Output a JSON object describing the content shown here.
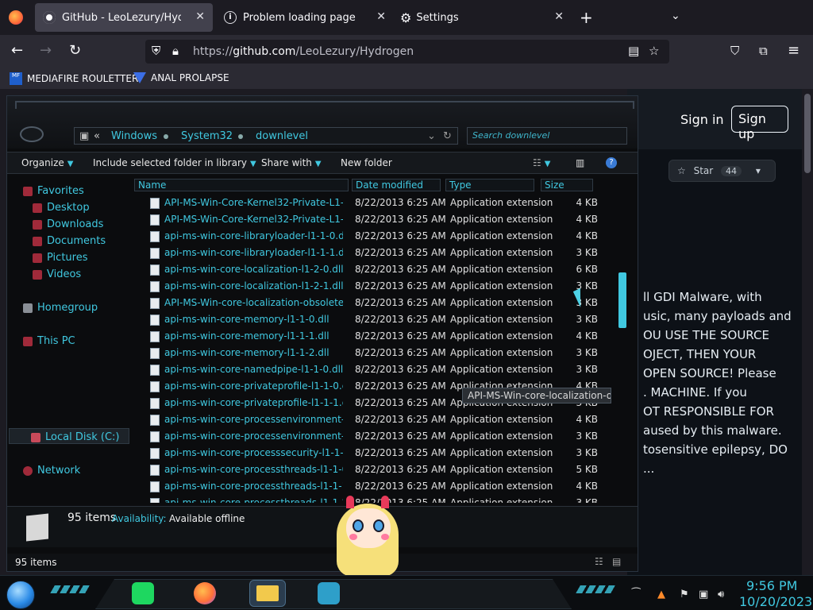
{
  "browser": {
    "tabs": [
      {
        "title": "GitHub - LeoLezury/Hydrogen",
        "icon": "github-icon"
      },
      {
        "title": "Problem loading page",
        "icon": "info-icon"
      },
      {
        "title": "Settings",
        "icon": "gear-icon"
      }
    ],
    "url_prefix": "https://",
    "url_domain": "github.com",
    "url_path": "/LeoLezury/Hydrogen",
    "bookmarks": [
      {
        "label": "MEDIAFIRE ROULETTER",
        "icon_text": "MF"
      },
      {
        "label": "ANAL PROLAPSE",
        "icon": "triangle-icon"
      }
    ]
  },
  "github": {
    "sign_in": "Sign in",
    "sign_up": "Sign up",
    "star_label": "Star",
    "star_count": "44",
    "readme_lines": [
      "ll GDI Malware, with",
      "usic, many payloads and",
      "OU USE THE SOURCE",
      "OJECT, THEN YOUR",
      " OPEN SOURCE! Please",
      ". MACHINE. If you",
      "OT RESPONSIBLE FOR",
      "aused by this malware.",
      "tosensitive epilepsy, DO",
      "..."
    ]
  },
  "explorer": {
    "breadcrumb": [
      "Windows",
      "System32",
      "downlevel"
    ],
    "breadcrumb_prefix": "«",
    "search_placeholder": "Search downlevel",
    "commands": {
      "organize": "Organize",
      "include": "Include selected folder in library",
      "share": "Share with",
      "new_folder": "New folder"
    },
    "nav": {
      "favorites": "Favorites",
      "desktop": "Desktop",
      "downloads": "Downloads",
      "documents": "Documents",
      "pictures": "Pictures",
      "videos": "Videos",
      "homegroup": "Homegroup",
      "this_pc": "This PC",
      "local_disk": "Local Disk (C:)",
      "network": "Network"
    },
    "columns": {
      "name": "Name",
      "date": "Date modified",
      "type": "Type",
      "size": "Size"
    },
    "files": [
      {
        "name": "API-MS-Win-Core-Kernel32-Private-L1-1-0.dll",
        "date": "8/22/2013 6:25 AM",
        "type": "Application extension",
        "size": "4 KB"
      },
      {
        "name": "API-MS-Win-Core-Kernel32-Private-L1-1-1.dll",
        "date": "8/22/2013 6:25 AM",
        "type": "Application extension",
        "size": "4 KB"
      },
      {
        "name": "api-ms-win-core-libraryloader-l1-1-0.dll",
        "date": "8/22/2013 6:25 AM",
        "type": "Application extension",
        "size": "4 KB"
      },
      {
        "name": "api-ms-win-core-libraryloader-l1-1-1.dll",
        "date": "8/22/2013 6:25 AM",
        "type": "Application extension",
        "size": "3 KB"
      },
      {
        "name": "api-ms-win-core-localization-l1-2-0.dll",
        "date": "8/22/2013 6:25 AM",
        "type": "Application extension",
        "size": "6 KB"
      },
      {
        "name": "api-ms-win-core-localization-l1-2-1.dll",
        "date": "8/22/2013 6:25 AM",
        "type": "Application extension",
        "size": "3 KB"
      },
      {
        "name": "API-MS-Win-core-localization-obsolete-l1-...",
        "date": "8/22/2013 6:25 AM",
        "type": "Application extension",
        "size": "3 KB"
      },
      {
        "name": "api-ms-win-core-memory-l1-1-0.dll",
        "date": "8/22/2013 6:25 AM",
        "type": "Application extension",
        "size": "3 KB"
      },
      {
        "name": "api-ms-win-core-memory-l1-1-1.dll",
        "date": "8/22/2013 6:25 AM",
        "type": "Application extension",
        "size": "4 KB"
      },
      {
        "name": "api-ms-win-core-memory-l1-1-2.dll",
        "date": "8/22/2013 6:25 AM",
        "type": "Application extension",
        "size": "3 KB"
      },
      {
        "name": "api-ms-win-core-namedpipe-l1-1-0.dll",
        "date": "8/22/2013 6:25 AM",
        "type": "Application extension",
        "size": "3 KB"
      },
      {
        "name": "api-ms-win-core-privateprofile-l1-1-0.dll",
        "date": "8/22/2013 6:25 AM",
        "type": "Application extension",
        "size": "4 KB"
      },
      {
        "name": "api-ms-win-core-privateprofile-l1-1-1.dll",
        "date": "8/22/2013 6:25 AM",
        "type": "Application extension",
        "size": "3 KB"
      },
      {
        "name": "api-ms-win-core-processenvironment-l1-1-...",
        "date": "8/22/2013 6:25 AM",
        "type": "Application extension",
        "size": "4 KB"
      },
      {
        "name": "api-ms-win-core-processenvironment-l1-2-...",
        "date": "8/22/2013 6:25 AM",
        "type": "Application extension",
        "size": "3 KB"
      },
      {
        "name": "api-ms-win-core-processsecurity-l1-1-0.dll",
        "date": "8/22/2013 6:25 AM",
        "type": "Application extension",
        "size": "3 KB"
      },
      {
        "name": "api-ms-win-core-processthreads-l1-1-0.dll",
        "date": "8/22/2013 6:25 AM",
        "type": "Application extension",
        "size": "5 KB"
      },
      {
        "name": "api-ms-win-core-processthreads-l1-1-1.dll",
        "date": "8/22/2013 6:25 AM",
        "type": "Application extension",
        "size": "4 KB"
      },
      {
        "name": "api-ms-win-core-processthreads-l1-1-2.dll",
        "date": "8/22/2013 6:25 AM",
        "type": "Application extension",
        "size": "3 KB"
      }
    ],
    "tooltip": "API-MS-Win-core-localization-ob...",
    "details_count": "95 items",
    "availability_label": "Availability:",
    "availability_value": "Available offline",
    "status_count": "95 items"
  },
  "taskbar": {
    "time": "9:56 PM",
    "date": "10/20/2023"
  },
  "colors": {
    "accent": "#40c8e0",
    "browser_bg": "#1c1b22",
    "github_bg": "#0d1117"
  }
}
